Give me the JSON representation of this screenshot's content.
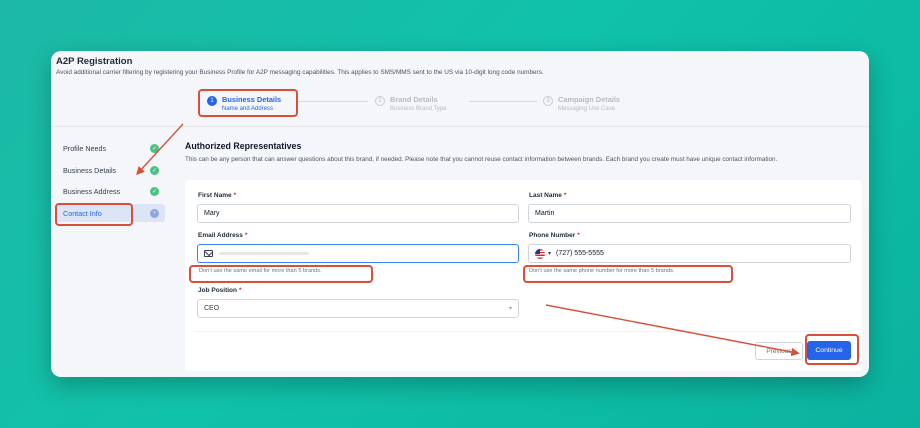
{
  "header": {
    "title": "A2P Registration",
    "subtitle": "Avoid additional carrier filtering by registering your Business Profile for A2P messaging capabilities. This applies to SMS/MMS sent to the US via 10-digit long code numbers."
  },
  "stepper": [
    {
      "num": "1",
      "label": "Business Details",
      "sub": "Name and Address",
      "state": "active"
    },
    {
      "num": "2",
      "label": "Brand Details",
      "sub": "Business Brand Type",
      "state": "inactive"
    },
    {
      "num": "3",
      "label": "Campaign Details",
      "sub": "Messaging Use Case",
      "state": "inactive"
    }
  ],
  "sidebar": [
    {
      "label": "Profile Needs",
      "status": "complete"
    },
    {
      "label": "Business Details",
      "status": "complete"
    },
    {
      "label": "Business Address",
      "status": "complete"
    },
    {
      "label": "Contact Info",
      "status": "current"
    }
  ],
  "section": {
    "title": "Authorized Representatives",
    "description": "This can be any person that can answer questions about this brand, if needed. Please note that you cannot reuse contact information between brands. Each brand you create must have unique contact information."
  },
  "form": {
    "first_name": {
      "label": "First Name",
      "required": "*",
      "value": "Mary"
    },
    "last_name": {
      "label": "Last Name",
      "required": "*",
      "value": "Martin"
    },
    "email": {
      "label": "Email Address",
      "required": "*",
      "value": "",
      "hint": "Don't use the same email for more than 5 brands."
    },
    "phone": {
      "label": "Phone Number",
      "required": "*",
      "value": "(727) 555-5555",
      "hint": "Don't use the same phone number for more than 5 brands.",
      "country": "US"
    },
    "job_position": {
      "label": "Job Position",
      "required": "*",
      "value": "CEO"
    }
  },
  "buttons": {
    "previous": "Previous",
    "continue": "Continue"
  },
  "colors": {
    "accent": "#2563eb",
    "success": "#49c281",
    "annotation": "#d9503a",
    "background": "#10c2a8"
  },
  "icons": {
    "check": "check-icon",
    "arrow": "chevron-right-icon",
    "email": "envelope-icon",
    "flag": "us-flag-icon"
  }
}
